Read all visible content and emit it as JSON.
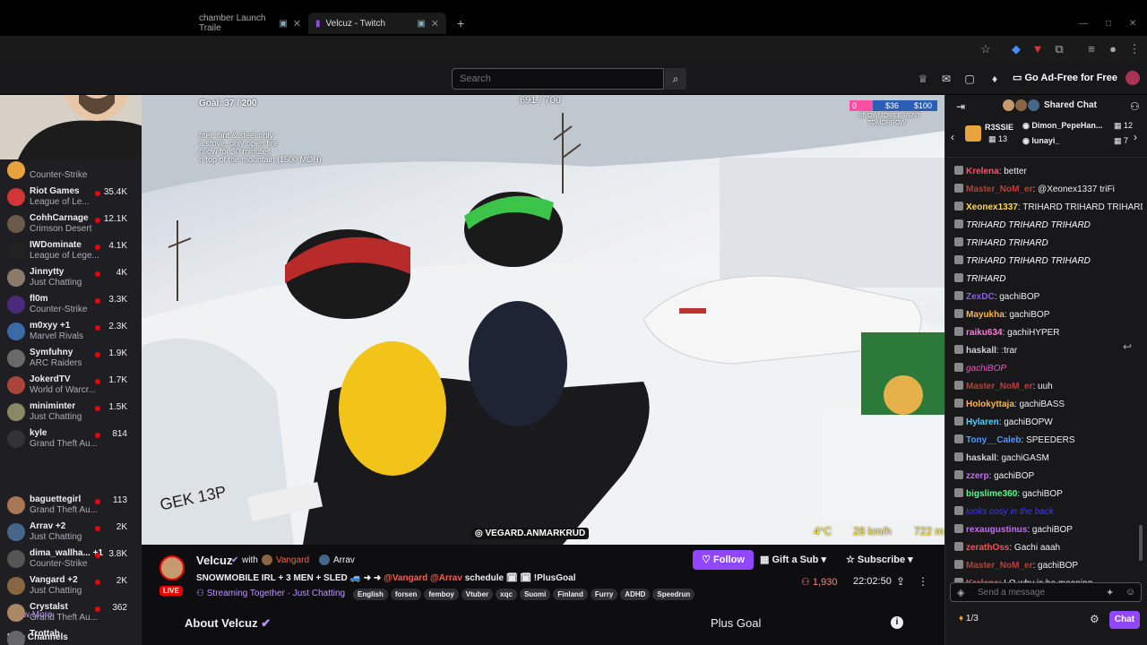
{
  "browser": {
    "tabs": [
      {
        "label": "chamber Launch Traile"
      },
      {
        "label": "Velcuz - Twitch"
      }
    ],
    "new_tab": "+"
  },
  "header": {
    "search_placeholder": "Search",
    "ad_free": "Go Ad-Free for Free"
  },
  "sidebar": {
    "followed": [
      {
        "name": "",
        "game": "Counter-Strike",
        "viewers": "",
        "color": "#e7a33e"
      },
      {
        "name": "Riot Games",
        "game": "League of Le...",
        "viewers": "35.4K",
        "color": "#d13639"
      },
      {
        "name": "CohhCarnage",
        "game": "Crimson Desert",
        "viewers": "12.1K",
        "color": "#6a5a4a"
      },
      {
        "name": "IWDominate",
        "game": "League of Lege...",
        "viewers": "4.1K",
        "color": "#222222"
      },
      {
        "name": "Jinnytty",
        "game": "Just Chatting",
        "viewers": "4K",
        "color": "#8a7a6a"
      },
      {
        "name": "fl0m",
        "game": "Counter-Strike",
        "viewers": "3.3K",
        "color": "#4a2a7a"
      },
      {
        "name": "m0xyy +1",
        "game": "Marvel Rivals",
        "viewers": "2.3K",
        "color": "#3a6aa8"
      },
      {
        "name": "Symfuhny",
        "game": "ARC Raiders",
        "viewers": "1.9K",
        "color": "#6a6a6a"
      },
      {
        "name": "JokerdTV",
        "game": "World of Warcr...",
        "viewers": "1.7K",
        "color": "#a8443a"
      },
      {
        "name": "miniminter",
        "game": "Just Chatting",
        "viewers": "1.5K",
        "color": "#888866"
      },
      {
        "name": "kyle",
        "game": "Grand Theft Au...",
        "viewers": "814",
        "color": "#333333"
      }
    ],
    "show_more": "Show More",
    "live_channels_title": "Live Channels",
    "live": [
      {
        "name": "baguettegirl",
        "game": "Grand Theft Au...",
        "viewers": "113",
        "color": "#aa7755"
      },
      {
        "name": "Arrav +2",
        "game": "Just Chatting",
        "viewers": "2K",
        "color": "#446688"
      },
      {
        "name": "dima_wallha... +1",
        "game": "Counter-Strike",
        "viewers": "3.8K",
        "color": "#555555"
      },
      {
        "name": "Vangard +2",
        "game": "Just Chatting",
        "viewers": "2K",
        "color": "#886644"
      },
      {
        "name": "Crystalst",
        "game": "Grand Theft Au...",
        "viewers": "362",
        "color": "#aa8866"
      },
      {
        "name": "Trottah",
        "game": "",
        "viewers": "",
        "color": "#666666"
      }
    ]
  },
  "video": {
    "goal_left": "Goal: 37 / 200",
    "goal_center": "691 / 700",
    "overlay_lines": [
      "hter, flint & steel only",
      "a stove, only open fire",
      "ollow for 30 minutes",
      "n top of the mountain (1500 MOH)"
    ],
    "donation": {
      "zero": "0",
      "v1": "$36",
      "v2": "$100",
      "label1": "SNOWMOBILE RENT",
      "label2": "TOMORROW"
    },
    "watermark": "VEGARD.ANMARKRUD",
    "plate": "GEK 13P",
    "temp": "4°C",
    "speed": "28 km/h",
    "alt": "722 m"
  },
  "stream": {
    "name": "Velcuz",
    "with": "with",
    "partner1": "Vangard",
    "partner2": "Arrav",
    "live": "LIVE",
    "title_a": "SNOWMOBILE IRL + 3 MEN + SLED 🚙 ➜ ➜ ",
    "title_mentions": "@Vangard @Arrav",
    "title_b": " schedule 🗓 🗓 !PlusGoal ",
    "shared": "Streaming Together",
    "category": "Just Chatting",
    "tags": [
      "English",
      "forsen",
      "femboy",
      "Vtuber",
      "xqc",
      "Suomi",
      "Finland",
      "Furry",
      "ADHD",
      "Speedrun"
    ],
    "follow": "Follow",
    "gift": "Gift a Sub",
    "subscribe": "Subscribe",
    "viewers": "1,930",
    "uptime": "22:02:50",
    "about": "About Velcuz",
    "plus_goal": "Plus Goal"
  },
  "chat": {
    "title": "Shared Chat",
    "pin1_user": "R3SSIE",
    "pin1_count": "13",
    "pin2_user": "Dimon_PepeHan...",
    "pin2_count": "12",
    "pin3_user": "lunayi_",
    "pin3_count": "7",
    "messages": [
      {
        "user": "Krelena",
        "color": "#ff4f6a",
        "text": "better"
      },
      {
        "user": "Master_NoM_er",
        "color": "#c23b3b",
        "text": "@Xeonex1337 triFi"
      },
      {
        "user": "Xeonex1337",
        "color": "#ffd84a",
        "text": "TRIHARD TRIHARD TRIHARD"
      },
      {
        "user": "",
        "color": "#ffffff",
        "text": "TRIHARD TRIHARD TRIHARD"
      },
      {
        "user": "",
        "color": "#ffffff",
        "text": "TRIHARD TRIHARD"
      },
      {
        "user": "",
        "color": "#ffffff",
        "text": "TRIHARD TRIHARD TRIHARD"
      },
      {
        "user": "",
        "color": "#ffffff",
        "text": "TRIHARD"
      },
      {
        "user": "ZexDC",
        "color": "#8a5cff",
        "text": "gachiBOP"
      },
      {
        "user": "Mayukha",
        "color": "#ffb347",
        "text": "gachiBOP"
      },
      {
        "user": "raiku634",
        "color": "#ff7ad9",
        "text": "gachiHYPER"
      },
      {
        "user": "haskall",
        "color": "#d0d0d0",
        "text": ":trar"
      },
      {
        "user": "",
        "color": "#ff4fbf",
        "text": "gachiBOP"
      },
      {
        "user": "Master_NoM_er",
        "color": "#c23b3b",
        "text": "uuh"
      },
      {
        "user": "Holokyttaja",
        "color": "#ffb347",
        "text": "gachiBASS"
      },
      {
        "user": "Hylaren",
        "color": "#4fd1ff",
        "text": "gachiBOPW"
      },
      {
        "user": "Tony__Caleb",
        "color": "#4f9bff",
        "text": "SPEEDERS"
      },
      {
        "user": "haskall",
        "color": "#d0d0d0",
        "text": "gachiGASM"
      },
      {
        "user": "zzerp",
        "color": "#c36bff",
        "text": "gachiBOP"
      },
      {
        "user": "bigslime360",
        "color": "#4fff8a",
        "text": "gachiBOP"
      },
      {
        "user": "",
        "color": "#3b3bff",
        "text": "looks cosy in the back"
      },
      {
        "user": "rexaugustinus",
        "color": "#c36bff",
        "text": "gachiBOP"
      },
      {
        "user": "zerathOss",
        "color": "#ff4f4f",
        "text": "Gachi aaah"
      },
      {
        "user": "Master_NoM_er",
        "color": "#c23b3b",
        "text": "gachiBOP"
      },
      {
        "user": "Krelena",
        "color": "#ff4f6a",
        "text": "LO why is he moaning"
      }
    ],
    "send_placeholder": "Send a message",
    "points": "1/3",
    "chat_button": "Chat"
  }
}
